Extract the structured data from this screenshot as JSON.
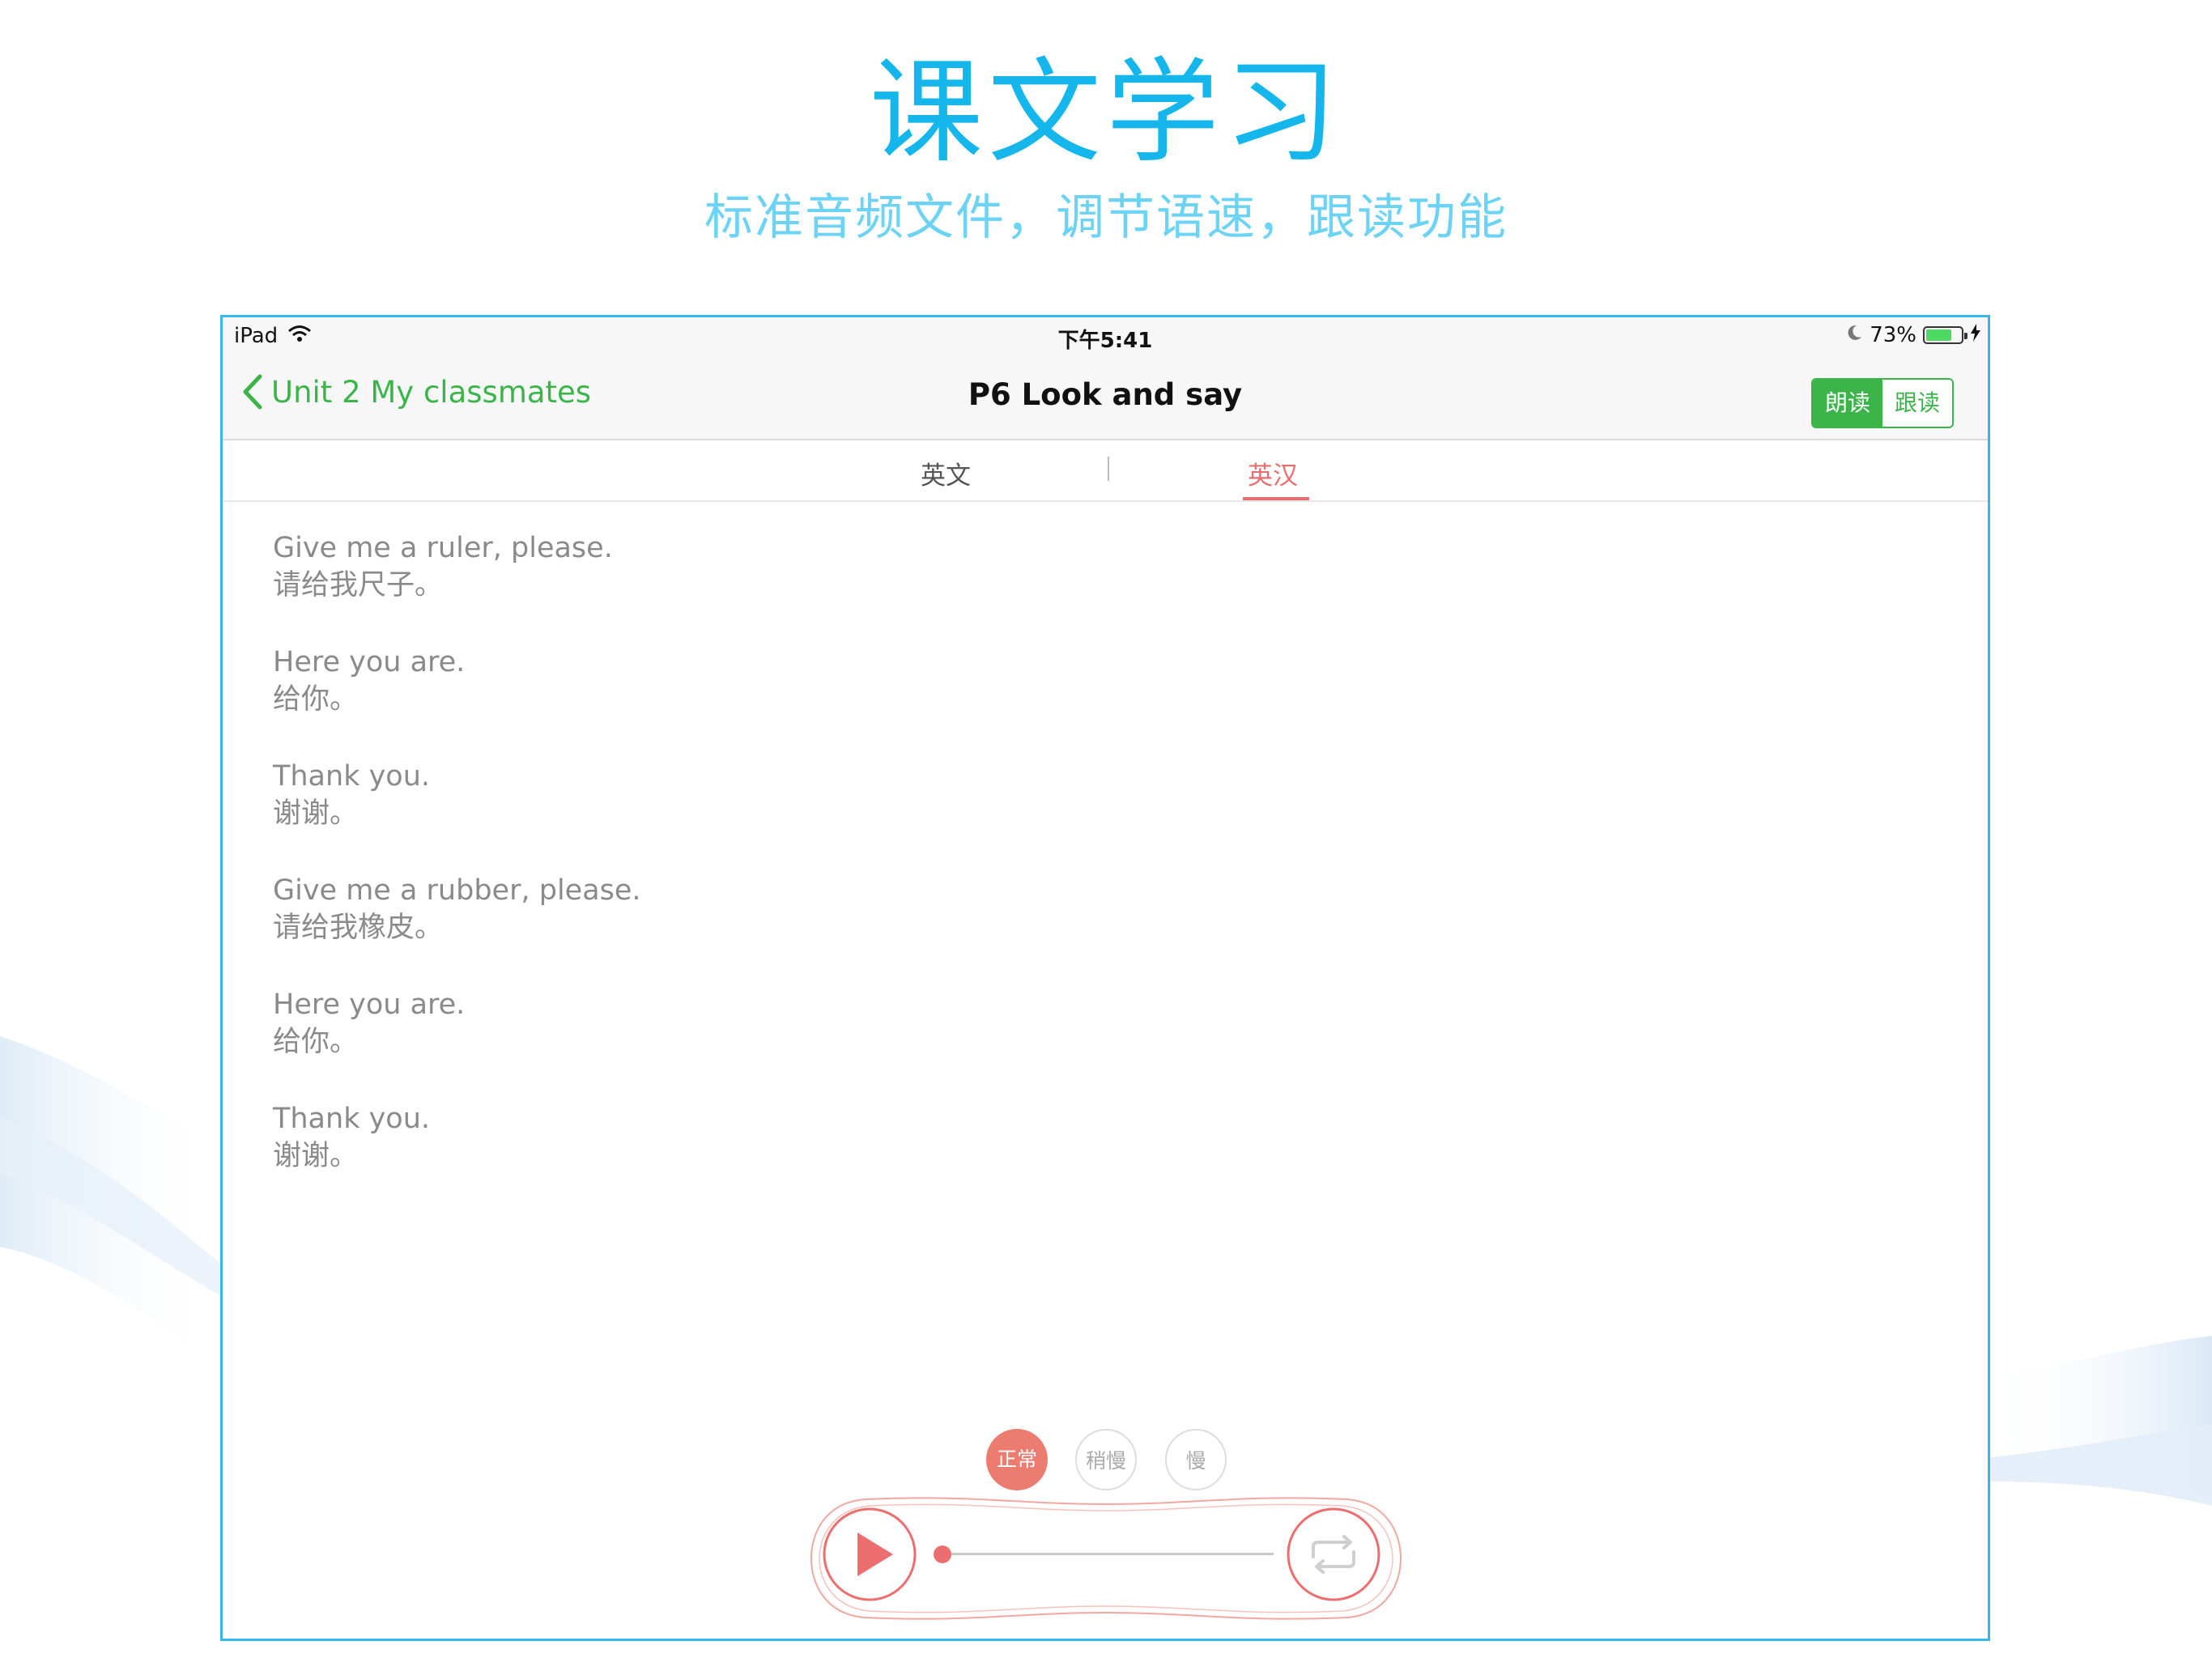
{
  "promo": {
    "title": "课文学习",
    "subtitle": "标准音频文件，调节语速，跟读功能"
  },
  "status_bar": {
    "device": "iPad",
    "time": "下午5:41",
    "battery": "73%",
    "battery_level": 0.73,
    "icons": [
      "wifi-icon",
      "moon-icon",
      "battery-icon",
      "charging-icon"
    ]
  },
  "nav": {
    "back_label": "Unit 2 My classmates",
    "title": "P6 Look and say",
    "mode_read": "朗读",
    "mode_follow": "跟读",
    "accent": "#3bb54a"
  },
  "tabs": {
    "english": "英文",
    "english_chinese": "英汉",
    "active_color": "#e96d6d"
  },
  "sentences": [
    {
      "en": "Give me a ruler, please.",
      "zh": "请给我尺子。"
    },
    {
      "en": "Here you are.",
      "zh": "给你。"
    },
    {
      "en": "Thank you.",
      "zh": "谢谢。"
    },
    {
      "en": "Give me a rubber, please.",
      "zh": "请给我橡皮。"
    },
    {
      "en": "Here you are.",
      "zh": "给你。"
    },
    {
      "en": "Thank you.",
      "zh": "谢谢。"
    }
  ],
  "speeds": {
    "normal": "正常",
    "slower": "稍慢",
    "slow": "慢",
    "selected": "normal"
  },
  "player": {
    "progress": 0.0,
    "accent": "#ec6e6e",
    "icons": [
      "play-icon",
      "repeat-icon"
    ]
  }
}
